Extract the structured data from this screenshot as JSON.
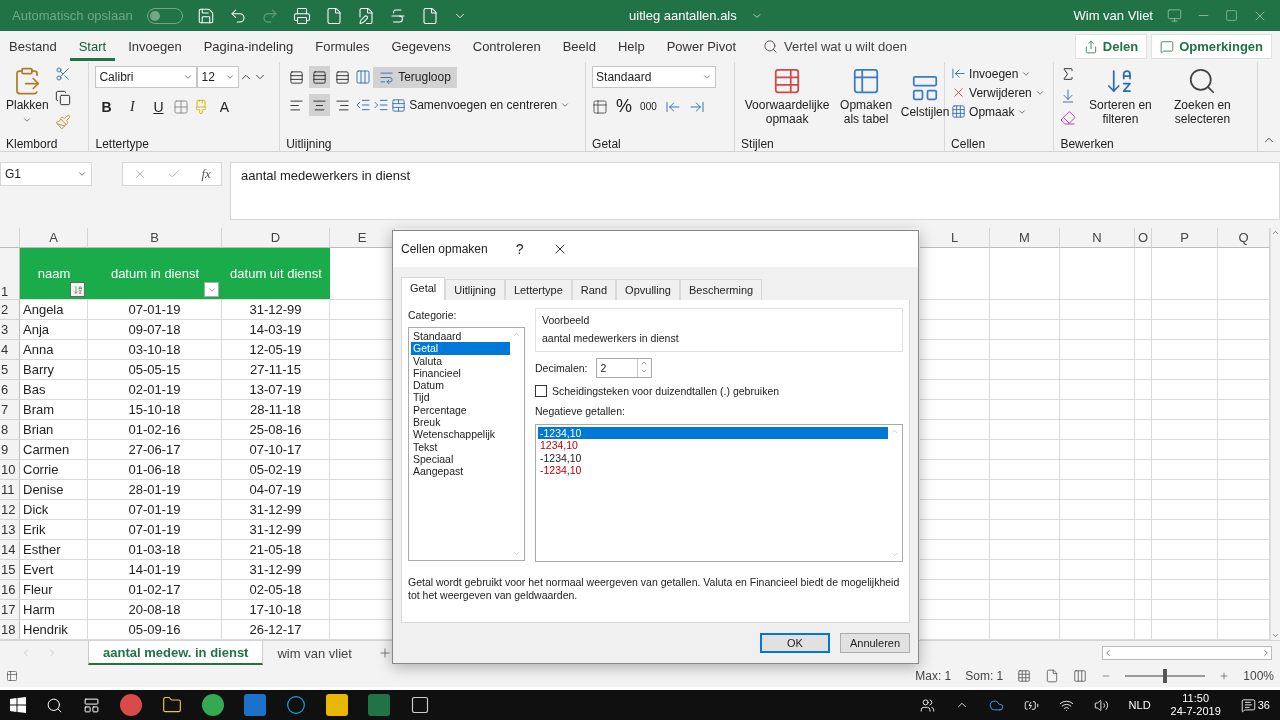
{
  "title_bar": {
    "autosave": {
      "label": "Automatisch opslaan",
      "on": false
    },
    "file_name": "uitleg aantallen.als",
    "user": "Wim van Vliet"
  },
  "menu": {
    "tabs": [
      {
        "label": "Bestand",
        "selected": false
      },
      {
        "label": "Start",
        "selected": true
      },
      {
        "label": "Invoegen",
        "selected": false
      },
      {
        "label": "Pagina-indeling",
        "selected": false
      },
      {
        "label": "Formules",
        "selected": false
      },
      {
        "label": "Gegevens",
        "selected": false
      },
      {
        "label": "Controleren",
        "selected": false
      },
      {
        "label": "Beeld",
        "selected": false
      },
      {
        "label": "Help",
        "selected": false
      },
      {
        "label": "Power Pivot",
        "selected": false
      }
    ],
    "search": {
      "placeholder": "Vertel wat u wilt doen"
    },
    "share": "Delen",
    "comments": "Opmerkingen"
  },
  "ribbon": {
    "groups": [
      {
        "kind": "clipboard",
        "label": "Klembord",
        "paste": "Plakken"
      },
      {
        "kind": "font",
        "label": "Lettertype",
        "font": "Calibri",
        "size": "12",
        "bold": "B",
        "italic": "I",
        "underline": "U",
        "color_letter": "A"
      },
      {
        "kind": "alignment",
        "label": "Uitlijning",
        "vertical": [
          {
            "selected": false
          },
          {
            "selected": true
          },
          {
            "selected": false
          }
        ],
        "horizontal": [
          {
            "selected": false
          },
          {
            "selected": true
          },
          {
            "selected": false
          }
        ],
        "wrap": {
          "label": "Terugloop",
          "on": true
        },
        "merge": "Samenvoegen en centreren"
      },
      {
        "kind": "number",
        "label": "Getal",
        "format": "Standaard",
        "percent": "%",
        "thousands": "000"
      },
      {
        "kind": "styles",
        "label": "Stijlen",
        "buttons": [
          "Voorwaardelijke opmaak",
          "Opmaken als tabel",
          "Celstijlen"
        ]
      },
      {
        "kind": "cells",
        "label": "Cellen",
        "buttons": [
          "Invoegen",
          "Verwijderen",
          "Opmaak"
        ]
      },
      {
        "kind": "editing",
        "label": "Bewerken",
        "buttons": [
          "Sorteren en filteren",
          "Zoeken en selecteren"
        ]
      }
    ]
  },
  "formula_bar": {
    "name_box": "G1",
    "fx": "fx",
    "formula": "aantal medewerkers in dienst"
  },
  "sheet": {
    "columns": [
      "A",
      "B",
      "D",
      "E",
      "L",
      "M",
      "N",
      "O",
      "P",
      "Q"
    ],
    "header_row": {
      "number": "1",
      "cells": [
        {
          "text": "naam",
          "filter": true,
          "sorted": true
        },
        {
          "text": "datum in dienst",
          "filter": true,
          "sorted": false
        },
        {
          "text": "datum uit dienst",
          "filter": false
        }
      ]
    },
    "rows": [
      {
        "number": "2",
        "cells": [
          "Angela",
          "07-01-19",
          "31-12-99"
        ]
      },
      {
        "number": "3",
        "cells": [
          "Anja",
          "09-07-18",
          "14-03-19"
        ]
      },
      {
        "number": "4",
        "cells": [
          "Anna",
          "03-10-18",
          "12-05-19"
        ]
      },
      {
        "number": "5",
        "cells": [
          "Barry",
          "05-05-15",
          "27-11-15"
        ]
      },
      {
        "number": "6",
        "cells": [
          "Bas",
          "02-01-19",
          "13-07-19"
        ]
      },
      {
        "number": "7",
        "cells": [
          "Bram",
          "15-10-18",
          "28-11-18"
        ]
      },
      {
        "number": "8",
        "cells": [
          "Brian",
          "01-02-16",
          "25-08-16"
        ]
      },
      {
        "number": "9",
        "cells": [
          "Carmen",
          "27-06-17",
          "07-10-17"
        ]
      },
      {
        "number": "10",
        "cells": [
          "Corrie",
          "01-06-18",
          "05-02-19"
        ]
      },
      {
        "number": "11",
        "cells": [
          "Denise",
          "28-01-19",
          "04-07-19"
        ]
      },
      {
        "number": "12",
        "cells": [
          "Dick",
          "07-01-19",
          "31-12-99"
        ]
      },
      {
        "number": "13",
        "cells": [
          "Erik",
          "07-01-19",
          "31-12-99"
        ]
      },
      {
        "number": "14",
        "cells": [
          "Esther",
          "01-03-18",
          "21-05-18"
        ]
      },
      {
        "number": "15",
        "cells": [
          "Evert",
          "14-01-19",
          "31-12-99"
        ]
      },
      {
        "number": "16",
        "cells": [
          "Fleur",
          "01-02-17",
          "02-05-18"
        ]
      },
      {
        "number": "17",
        "cells": [
          "Harm",
          "20-08-18",
          "17-10-18"
        ]
      },
      {
        "number": "18",
        "cells": [
          "Hendrik",
          "05-09-16",
          "26-12-17"
        ]
      }
    ]
  },
  "sheet_tabs": [
    {
      "label": "aantal medew. in dienst",
      "selected": true
    },
    {
      "label": "wim van vliet",
      "selected": false
    }
  ],
  "status_bar": {
    "stats": [
      "Max: 1",
      "Som: 1"
    ],
    "zoom": {
      "level": 0.5,
      "label": "100%"
    }
  },
  "dialog": {
    "title": "Cellen opmaken",
    "help": "?",
    "tabs": [
      {
        "label": "Getal",
        "selected": true
      },
      {
        "label": "Uitlijning",
        "selected": false
      },
      {
        "label": "Lettertype",
        "selected": false
      },
      {
        "label": "Rand",
        "selected": false
      },
      {
        "label": "Opvulling",
        "selected": false
      },
      {
        "label": "Bescherming",
        "selected": false
      }
    ],
    "category_label": "Categorie:",
    "categories": [
      {
        "label": "Standaard",
        "selected": false
      },
      {
        "label": "Getal",
        "selected": true
      },
      {
        "label": "Valuta",
        "selected": false
      },
      {
        "label": "Financieel",
        "selected": false
      },
      {
        "label": "Datum",
        "selected": false
      },
      {
        "label": "Tijd",
        "selected": false
      },
      {
        "label": "Percentage",
        "selected": false
      },
      {
        "label": "Breuk",
        "selected": false
      },
      {
        "label": "Wetenschappelijk",
        "selected": false
      },
      {
        "label": "Tekst",
        "selected": false
      },
      {
        "label": "Speciaal",
        "selected": false
      },
      {
        "label": "Aangepast",
        "selected": false
      }
    ],
    "preview_label": "Voorbeeld",
    "preview": "aantal medewerkers in dienst",
    "decimals_label": "Decimalen:",
    "decimals": "2",
    "thousands": {
      "label": "Scheidingsteken voor duizendtallen (.) gebruiken",
      "checked": false
    },
    "negative_label": "Negatieve getallen:",
    "negative_formats": [
      {
        "text": "-1234,10",
        "red": false,
        "selected": true
      },
      {
        "text": "1234,10",
        "red": true,
        "selected": false
      },
      {
        "text": "-1234,10",
        "red": false,
        "selected": false
      },
      {
        "text": "-1234,10",
        "red": true,
        "selected": false
      }
    ],
    "description": "Getal wordt gebruikt voor het normaal weergeven van getallen. Valuta en Financieel biedt de mogelijkheid tot het weergeven van geldwaarden.",
    "buttons": [
      {
        "label": "OK",
        "default": true
      },
      {
        "label": "Annuleren",
        "default": false
      }
    ]
  },
  "taskbar": {
    "language": "NLD",
    "time": "11:50",
    "date": "24-7-2019",
    "notifications": "36"
  }
}
